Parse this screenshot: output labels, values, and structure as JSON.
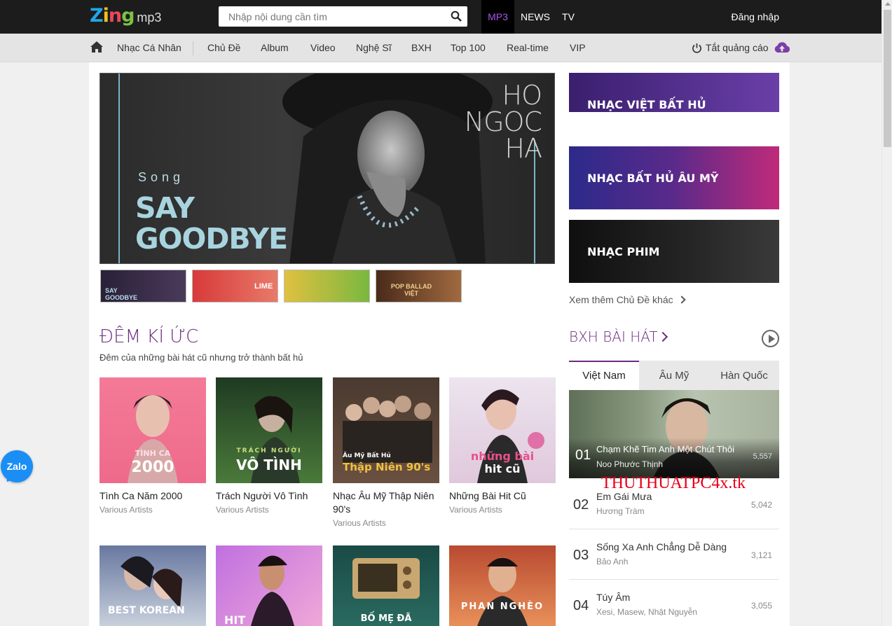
{
  "header": {
    "logo_zing": [
      "Z",
      "i",
      "n",
      "g"
    ],
    "logo_mp3": "mp3",
    "search_placeholder": "Nhập nội dung cần tìm",
    "nav": [
      "MP3",
      "NEWS",
      "TV"
    ],
    "login": "Đăng nhập"
  },
  "subnav": {
    "items": [
      "Nhạc Cá Nhân",
      "Chủ Đề",
      "Album",
      "Video",
      "Nghệ Sĩ",
      "BXH",
      "Top 100",
      "Real-time",
      "VIP"
    ],
    "ad_off": "Tắt quảng cáo"
  },
  "hero": {
    "song_label": "Song",
    "title_line1": "SAY",
    "title_line2": "GOODBYE",
    "artist": [
      "HO",
      "NGOC",
      "HA"
    ]
  },
  "thumbnails": [
    {
      "label": "SAY GOODBYE",
      "color": "#3a2a4a"
    },
    {
      "label": "LIME",
      "color": "#c8202a"
    },
    {
      "label": "",
      "color": "#e0b52a"
    },
    {
      "label": "POP BALLAD VIỆT",
      "color": "#6b3a22"
    }
  ],
  "banners": [
    {
      "label": "NHẠC VIỆT BẤT HỦ",
      "colors": [
        "#3a1f6e",
        "#6a3fa8"
      ]
    },
    {
      "label": "NHẠC BẤT HỦ ÂU MỸ",
      "colors": [
        "#2c2a8a",
        "#c02a7a"
      ]
    },
    {
      "label": "NHẠC PHIM",
      "colors": [
        "#0f0f0f",
        "#3a3a3a"
      ]
    }
  ],
  "more_topics": "Xem thêm Chủ Đề khác",
  "section": {
    "title": "ĐÊM KÍ ỨC",
    "subtitle": "Đêm của những bài hát cũ nhưng trở thành bất hủ"
  },
  "cards": [
    {
      "title": "Tình Ca Năm 2000",
      "artist": "Various Artists",
      "cover_top": "TÌNH CA",
      "cover_main": "2000",
      "bg": [
        "#f06a8a",
        "#f4a0b8"
      ]
    },
    {
      "title": "Trách Người Vô Tình",
      "artist": "Various Artists",
      "cover_top": "TRÁCH NGƯỜI",
      "cover_main": "VÔ TÌNH",
      "bg": [
        "#1f3a22",
        "#5a8a45"
      ]
    },
    {
      "title": "Nhạc Âu Mỹ Thập Niên 90's",
      "artist": "Various Artists",
      "cover_top": "Âu Mỹ Bất Hủ",
      "cover_main": "Thập Niên 90's",
      "bg": [
        "#3a2a22",
        "#7a6050"
      ]
    },
    {
      "title": "Những Bài Hit Cũ",
      "artist": "Various Artists",
      "cover_top": "những bài",
      "cover_main": "hit cũ",
      "bg": [
        "#e8e0ec",
        "#d8b8d0"
      ]
    }
  ],
  "cards_row2": [
    {
      "cover_text": "BEST KOREAN",
      "bg": [
        "#8898b0",
        "#c8d0dc"
      ]
    },
    {
      "cover_text": "HIT",
      "bg": [
        "#b05ad0",
        "#f0a8d8"
      ]
    },
    {
      "cover_text": "BỐ MẸ ĐÃ",
      "bg": [
        "#1f5a52",
        "#3a8a7a"
      ]
    },
    {
      "cover_text": "PHAN NGHÈO",
      "bg": [
        "#c85a3a",
        "#e89a5a"
      ]
    }
  ],
  "bxh": {
    "title": "BXH BÀI HÁT",
    "tabs": [
      "Việt Nam",
      "Âu Mỹ",
      "Hàn Quốc"
    ],
    "top": {
      "rank": "01",
      "title": "Chạm Khẽ Tim Anh Một Chút Thôi",
      "artist": "Noo Phước Thịnh",
      "count": "5,557"
    },
    "rows": [
      {
        "rank": "02",
        "title": "Em Gái Mưa",
        "artist": "Hương Tràm",
        "count": "5,042"
      },
      {
        "rank": "03",
        "title": "Sống Xa Anh Chẳng Dễ Dàng",
        "artist": "Bảo Anh",
        "count": "3,121"
      },
      {
        "rank": "04",
        "title": "Túy Âm",
        "artist": "Xesi, Masew, Nhật Nguyễn",
        "count": "3,055"
      }
    ]
  },
  "watermark": "THUTHUATPC4x.tk",
  "zalo": "Zalo",
  "colors": {
    "accent": "#6b2d80",
    "mp3_active": "#a855e8",
    "topbar": "#1c1c1c"
  }
}
